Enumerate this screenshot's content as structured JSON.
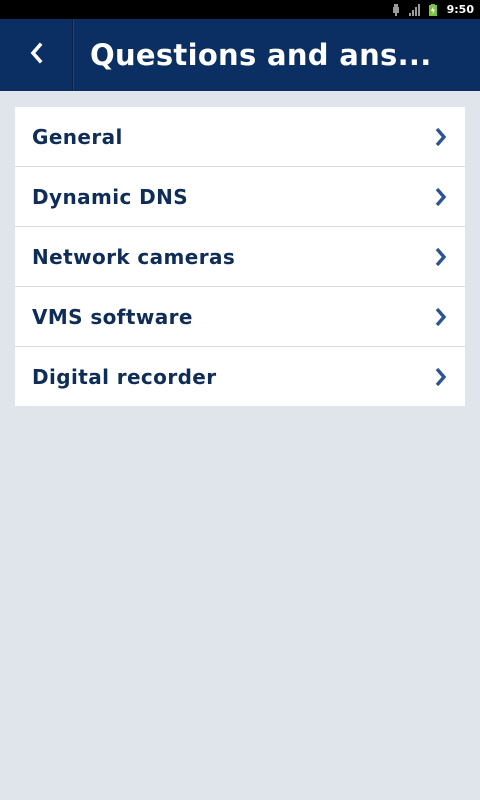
{
  "status_bar": {
    "time": "9:50",
    "icons": [
      "usb-icon",
      "signal-icon",
      "battery-charging-icon"
    ]
  },
  "header": {
    "title": "Questions and ans...",
    "back_icon": "chevron-left-icon",
    "background_color": "#0b2f63"
  },
  "menu": {
    "items": [
      {
        "label": "General",
        "icon": "chevron-right-icon"
      },
      {
        "label": "Dynamic DNS",
        "icon": "chevron-right-icon"
      },
      {
        "label": "Network cameras",
        "icon": "chevron-right-icon"
      },
      {
        "label": "VMS software",
        "icon": "chevron-right-icon"
      },
      {
        "label": "Digital recorder",
        "icon": "chevron-right-icon"
      }
    ]
  },
  "colors": {
    "page_background": "#dfe5eb",
    "text": "#0f2d56",
    "chevron": "#2c558f"
  }
}
